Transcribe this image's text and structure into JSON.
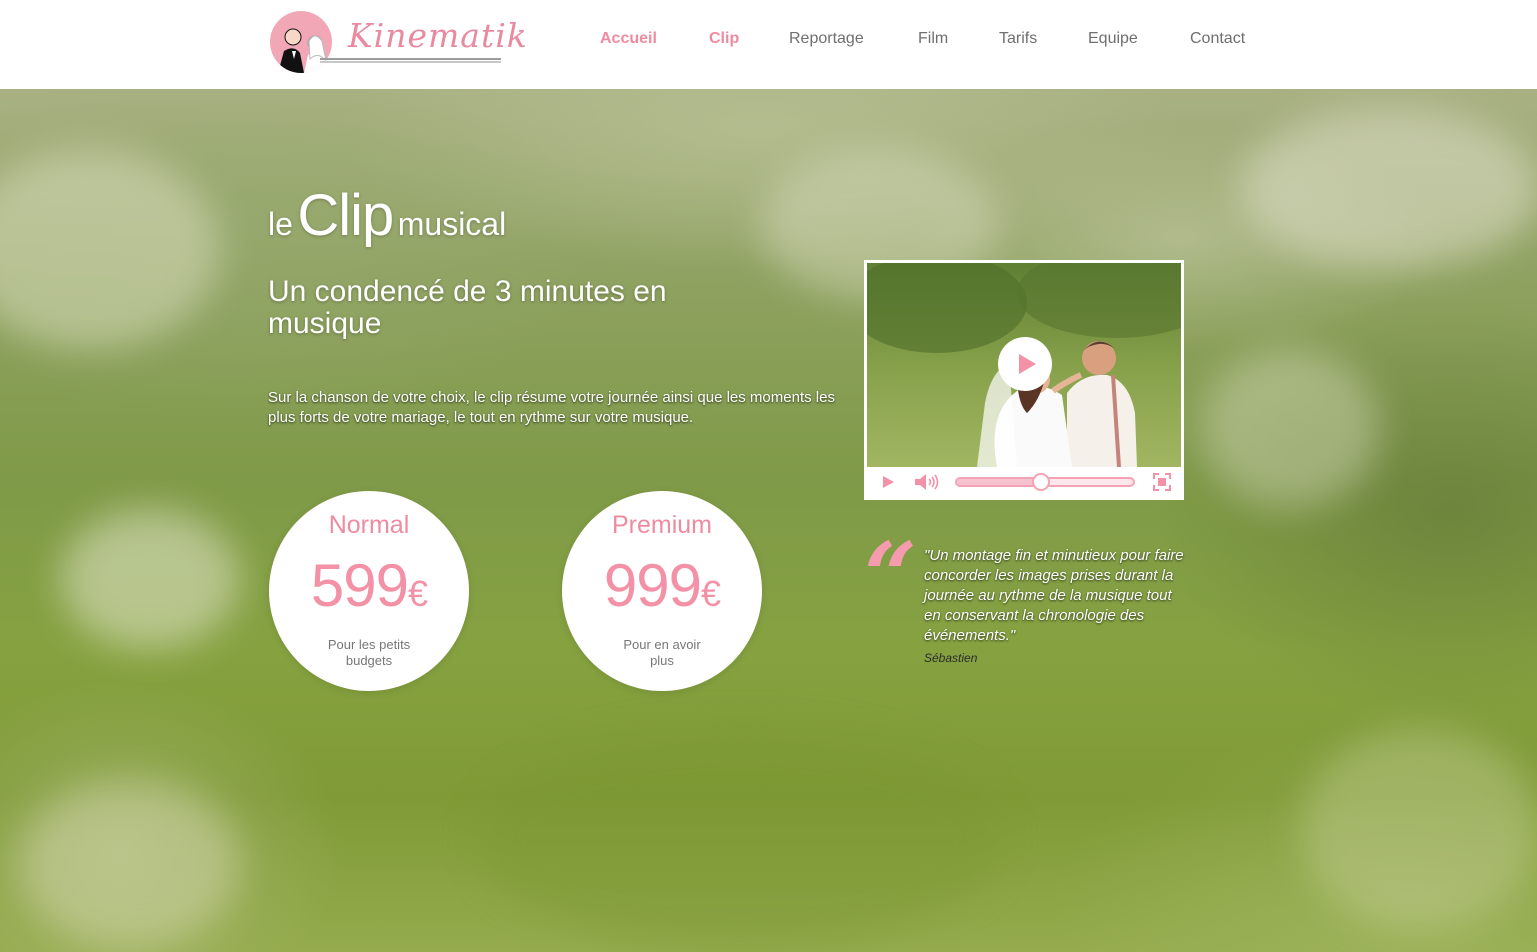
{
  "brand": {
    "name": "Kinematik"
  },
  "nav": {
    "items": [
      {
        "label": "Accueil",
        "active": true
      },
      {
        "label": "Clip",
        "active": true
      },
      {
        "label": "Reportage",
        "active": false
      },
      {
        "label": "Film",
        "active": false
      },
      {
        "label": "Tarifs",
        "active": false
      },
      {
        "label": "Equipe",
        "active": false
      },
      {
        "label": "Contact",
        "active": false
      }
    ]
  },
  "hero": {
    "title_prefix": "le",
    "title_main": "Clip",
    "title_suffix": "musical",
    "subtitle": "Un condencé de 3 minutes en musique",
    "description": "Sur la chanson de votre choix, le clip résume votre journée ainsi que les moments les plus forts de votre mariage, le tout en rythme sur votre musique."
  },
  "pricing": [
    {
      "name": "Normal",
      "amount": "599",
      "currency": "€",
      "note": "Pour les petits budgets"
    },
    {
      "name": "Premium",
      "amount": "999",
      "currency": "€",
      "note": "Pour en avoir plus"
    }
  ],
  "video": {
    "progress": 0.48,
    "icons": {
      "big_play": "play-icon",
      "play": "play-icon",
      "volume": "volume-icon",
      "fullscreen": "fullscreen-icon"
    }
  },
  "testimonial": {
    "quote": "\"Un montage fin et minutieux pour faire concorder les images prises durant la journée au rythme de la musique tout en conservant la chronologie des événements.\"",
    "author": "Sébastien"
  },
  "colors": {
    "accent": "#ef8ba0",
    "nav_text": "#6f6f6f",
    "header_bg": "#ffffff"
  }
}
